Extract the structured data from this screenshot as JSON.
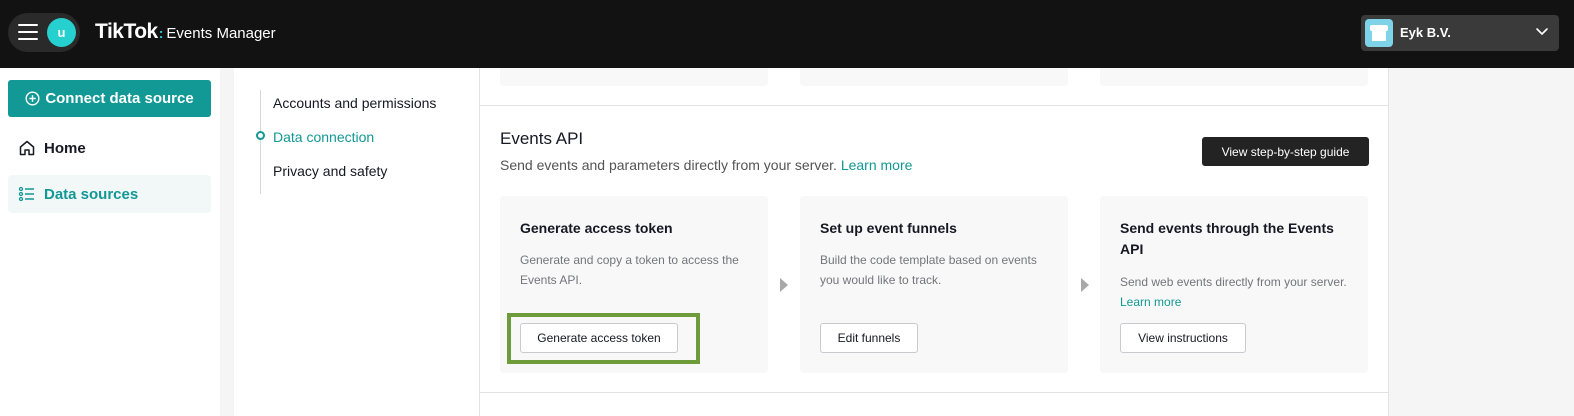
{
  "topbar": {
    "avatar_letter": "u",
    "brand_logo": "TikTok",
    "brand_separator": ":",
    "brand_product": "Events Manager",
    "account_name": "Eyk B.V."
  },
  "sidebar": {
    "connect_label": "Connect data source",
    "items": [
      {
        "label": "Home",
        "icon": "home-icon"
      },
      {
        "label": "Data sources",
        "icon": "list-icon",
        "active": true
      }
    ]
  },
  "settings_nav": {
    "items": [
      {
        "label": "Accounts and permissions"
      },
      {
        "label": "Data connection",
        "active": true
      },
      {
        "label": "Privacy and safety"
      }
    ]
  },
  "events_api": {
    "title": "Events API",
    "subtitle": "Send events and parameters directly from your server.",
    "subtitle_link": "Learn more",
    "guide_button": "View step-by-step guide",
    "steps": [
      {
        "title": "Generate access token",
        "description": "Generate and copy a token to access the Events API.",
        "button": "Generate access token"
      },
      {
        "title": "Set up event funnels",
        "description": "Build the code template based on events you would like to track.",
        "button": "Edit funnels"
      },
      {
        "title": "Send events through the Events API",
        "description": "Send web events directly from your server.",
        "description_link": "Learn more",
        "button": "View instructions"
      }
    ]
  },
  "colors": {
    "accent": "#129895",
    "topbar": "#121212",
    "highlight": "#6f9c3a"
  }
}
